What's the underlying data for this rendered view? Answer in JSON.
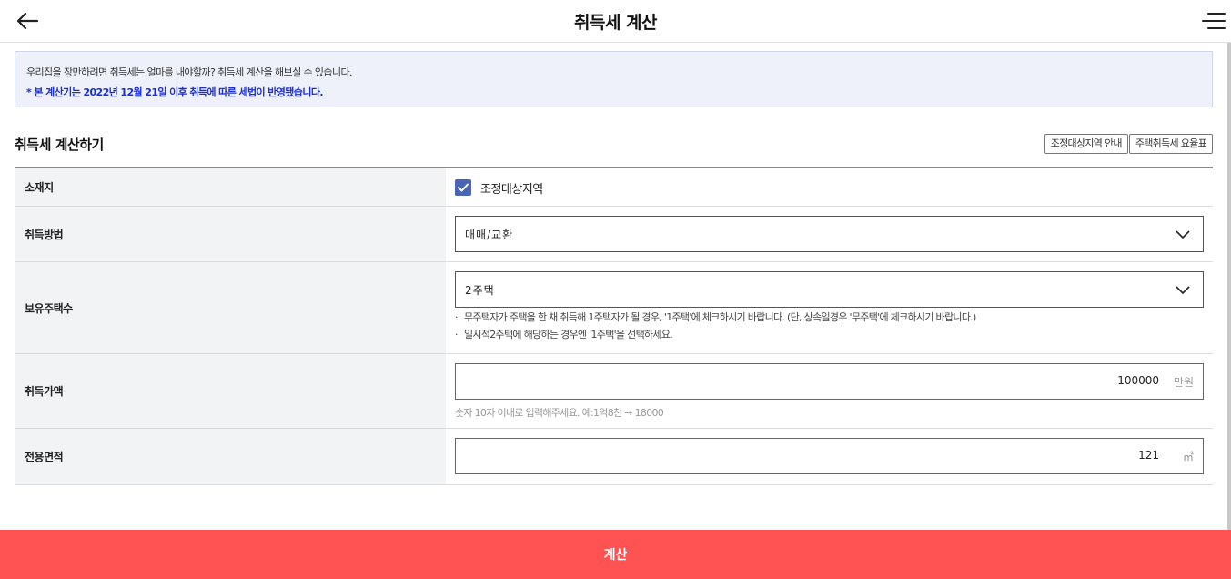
{
  "header": {
    "title": "취득세 계산"
  },
  "notice": {
    "line1": "우리집을 장만하려면 취득세는 얼마를 내야할까? 취득세 계산을 해보실 수 있습니다.",
    "line2": "* 본 계산기는 2022년 12월 21일 이후 취득에 따른 세법이 반영됐습니다."
  },
  "section": {
    "title": "취득세 계산하기",
    "buttons": [
      "조정대상지역 안내",
      "주택취득세 요율표"
    ]
  },
  "form": {
    "location": {
      "label": "소재지",
      "checkbox_label": "조정대상지역",
      "checked": true
    },
    "method": {
      "label": "취득방법",
      "value": "매매/교환"
    },
    "houses": {
      "label": "보유주택수",
      "value": "2주택",
      "hints": [
        "무주택자가 주택을 한 채 취득해 1주택자가 될 경우, '1주택'에 체크하시기 바랍니다. (단, 상속일경우 '무주택'에 체크하시기 바랍니다.)",
        "일시적2주택에 해당하는 경우엔 '1주택'을 선택하세요."
      ]
    },
    "price": {
      "label": "취득가액",
      "value": "100000",
      "unit": "만원",
      "hint": "숫자 10자 이내로 입력해주세요. 예:1억8천 → 18000"
    },
    "area": {
      "label": "전용면적",
      "value": "121",
      "unit": "㎡"
    }
  },
  "calc_button": {
    "label": "계산"
  },
  "colors": {
    "accent": "#ff5252",
    "checkbox": "#4a64b5",
    "notice_bg": "#eef1f9",
    "notice_blue": "#1a2dd8"
  }
}
